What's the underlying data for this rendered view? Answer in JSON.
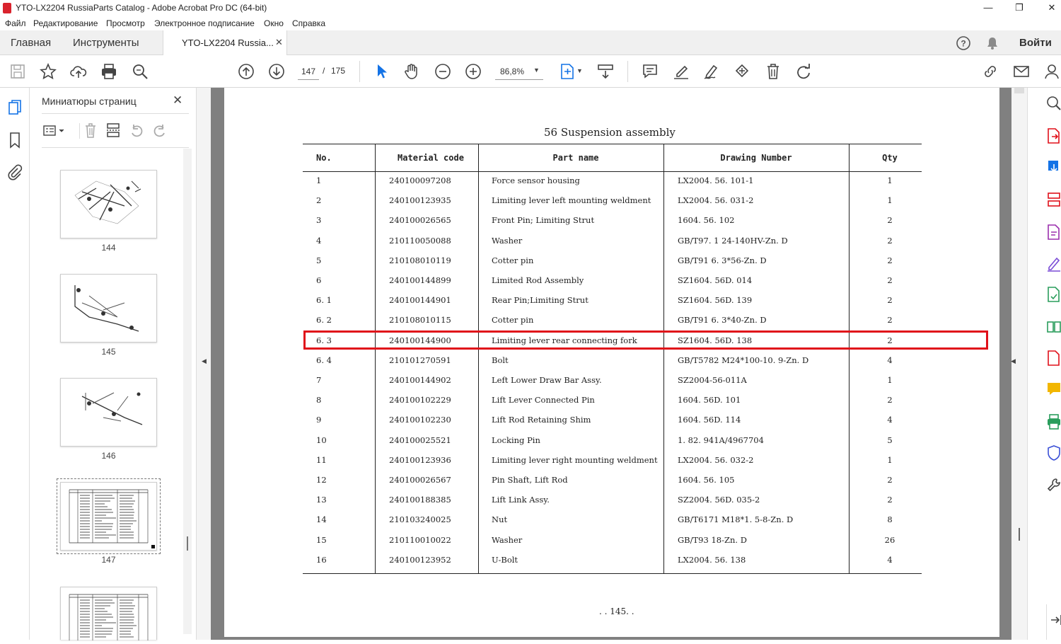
{
  "window": {
    "title": "YTO-LX2204 RussiaParts Catalog - Adobe Acrobat Pro DC (64-bit)",
    "minimize": "—",
    "maximize": "❐",
    "close": "✕"
  },
  "menu": [
    "Файл",
    "Редактирование",
    "Просмотр",
    "Электронное подписание",
    "Окно",
    "Справка"
  ],
  "tabs": {
    "home": "Главная",
    "tools": "Инструменты",
    "document": "YTO-LX2204 Russia...",
    "close": "✕"
  },
  "header_right": {
    "signin": "Войти"
  },
  "toolbar": {
    "current_page": "147",
    "page_sep": "/",
    "total_pages": "175",
    "zoom": "86,8%"
  },
  "thumbnails": {
    "title": "Миниатюры страниц",
    "close": "✕",
    "pages": [
      "144",
      "145",
      "146",
      "147"
    ]
  },
  "document": {
    "table_title": "56 Suspension assembly",
    "headers": [
      "No.",
      "Material code",
      "Part name",
      "Drawing Number",
      "Qty"
    ],
    "rows": [
      [
        "1",
        "240100097208",
        "Force sensor housing",
        "LX2004. 56. 101-1",
        "1"
      ],
      [
        "2",
        "240100123935",
        "Limiting lever left mounting weldment",
        "LX2004. 56. 031-2",
        "1"
      ],
      [
        "3",
        "240100026565",
        "Front Pin; Limiting Strut",
        "1604. 56. 102",
        "2"
      ],
      [
        "4",
        "210110050088",
        "Washer",
        "GB/T97. 1 24-140HV-Zn. D",
        "2"
      ],
      [
        "5",
        "210108010119",
        "Cotter pin",
        "GB/T91 6. 3*56-Zn. D",
        "2"
      ],
      [
        "6",
        "240100144899",
        "Limited Rod Assembly",
        "SZ1604. 56D. 014",
        "2"
      ],
      [
        "6. 1",
        "240100144901",
        "Rear Pin;Limiting Strut",
        "SZ1604. 56D. 139",
        "2"
      ],
      [
        "6. 2",
        "210108010115",
        "Cotter pin",
        "GB/T91 6. 3*40-Zn. D",
        "2"
      ],
      [
        "6. 3",
        "240100144900",
        "Limiting lever rear connecting fork",
        "SZ1604. 56D. 138",
        "2"
      ],
      [
        "6. 4",
        "210101270591",
        "Bolt",
        "GB/T5782 M24*100-10. 9-Zn. D",
        "4"
      ],
      [
        "7",
        "240100144902",
        "Left Lower Draw Bar Assy.",
        "SZ2004-56-011A",
        "1"
      ],
      [
        "8",
        "240100102229",
        "Lift Lever Connected Pin",
        "1604. 56D. 101",
        "2"
      ],
      [
        "9",
        "240100102230",
        "Lift Rod Retaining Shim",
        "1604. 56D. 114",
        "4"
      ],
      [
        "10",
        "240100025521",
        "Locking Pin",
        "1. 82. 941A/4967704",
        "5"
      ],
      [
        "11",
        "240100123936",
        "Limiting lever right mounting weldment",
        "LX2004. 56. 032-2",
        "1"
      ],
      [
        "12",
        "240100026567",
        "Pin Shaft, Lift Rod",
        "1604. 56. 105",
        "2"
      ],
      [
        "13",
        "240100188385",
        "Lift Link Assy.",
        "SZ2004. 56D. 035-2",
        "2"
      ],
      [
        "14",
        "210103240025",
        "Nut",
        "GB/T6171 M18*1. 5-8-Zn. D",
        "8"
      ],
      [
        "15",
        "210110010022",
        "Washer",
        "GB/T93 18-Zn. D",
        "26"
      ],
      [
        "16",
        "240100123952",
        "U-Bolt",
        "LX2004. 56. 138",
        "4"
      ]
    ],
    "highlighted_row": 8,
    "page_footer": ". . 145. ."
  },
  "colors": {
    "highlight": "#e0101a",
    "accent": "#1473e6",
    "doc_bg": "#808080"
  }
}
